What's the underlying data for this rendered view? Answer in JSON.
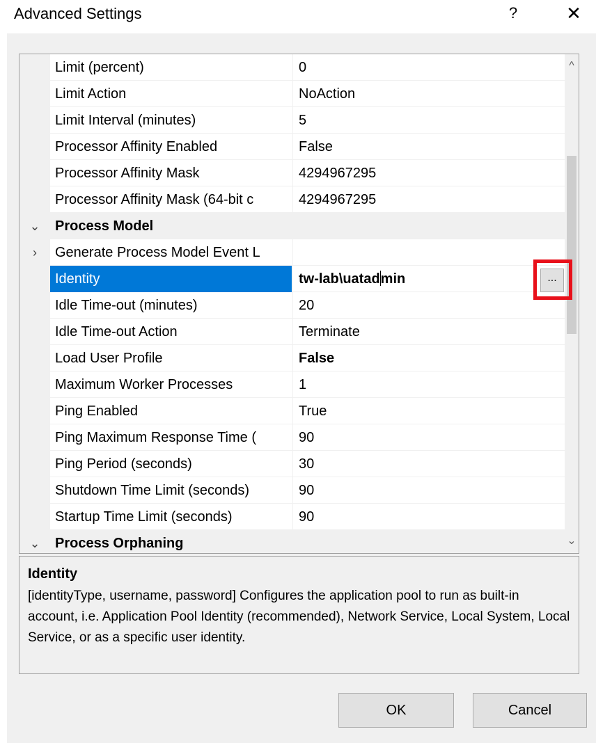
{
  "window": {
    "title": "Advanced Settings",
    "help_label": "?",
    "close_label": "✕"
  },
  "grid": {
    "rows": [
      {
        "name": "Limit (percent)",
        "value": "0"
      },
      {
        "name": "Limit Action",
        "value": "NoAction"
      },
      {
        "name": "Limit Interval (minutes)",
        "value": "5"
      },
      {
        "name": "Processor Affinity Enabled",
        "value": "False"
      },
      {
        "name": "Processor Affinity Mask",
        "value": "4294967295"
      },
      {
        "name": "Processor Affinity Mask (64-bit c",
        "value": "4294967295"
      },
      {
        "name": "Process Model",
        "toggle": "⌄",
        "category": true
      },
      {
        "name": "Generate Process Model Event L",
        "toggle": "›",
        "value": ""
      },
      {
        "name": "Identity",
        "value_before_caret": "tw-lab\\uatad",
        "value_after_caret": "min",
        "selected": true
      },
      {
        "name": "Idle Time-out (minutes)",
        "value": "20"
      },
      {
        "name": "Idle Time-out Action",
        "value": "Terminate"
      },
      {
        "name": "Load User Profile",
        "value": "False",
        "bold": true
      },
      {
        "name": "Maximum Worker Processes",
        "value": "1"
      },
      {
        "name": "Ping Enabled",
        "value": "True"
      },
      {
        "name": "Ping Maximum Response Time (",
        "value": "90"
      },
      {
        "name": "Ping Period (seconds)",
        "value": "30"
      },
      {
        "name": "Shutdown Time Limit (seconds)",
        "value": "90"
      },
      {
        "name": "Startup Time Limit (seconds)",
        "value": "90"
      },
      {
        "name": "Process Orphaning",
        "toggle": "⌄",
        "category": true
      }
    ],
    "ellipsis_label": "...",
    "scroll_up_icon": "^",
    "scroll_down_icon": "⌄"
  },
  "description": {
    "title": "Identity",
    "text": "[identityType, username, password] Configures the application pool to run as built-in account, i.e. Application Pool Identity (recommended), Network Service, Local System, Local Service, or as a specific user identity."
  },
  "buttons": {
    "ok": "OK",
    "cancel": "Cancel"
  },
  "colors": {
    "selection": "#0078d7",
    "highlight_box": "#e8101a",
    "dialog_background": "#f0f0f0"
  }
}
